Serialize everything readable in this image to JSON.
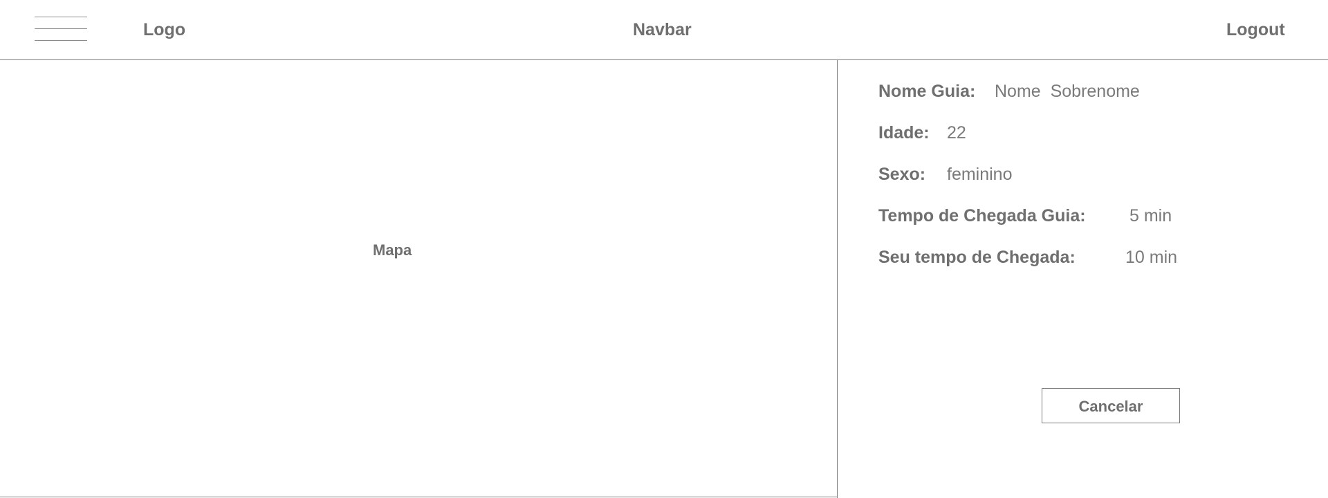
{
  "navbar": {
    "menu_icon": "hamburger-menu-icon",
    "logo_label": "Logo",
    "title": "Navbar",
    "logout_label": "Logout"
  },
  "map": {
    "label": "Mapa"
  },
  "guide_info": {
    "nome": {
      "label": "Nome Guia:",
      "value": "Nome  Sobrenome"
    },
    "idade": {
      "label": "Idade:",
      "value": "22"
    },
    "sexo": {
      "label": "Sexo:",
      "value": "feminino"
    },
    "tempo_guia": {
      "label": "Tempo de Chegada Guia:",
      "value": "5 min"
    },
    "tempo_seu": {
      "label": "Seu tempo de Chegada:",
      "value": "10 min"
    }
  },
  "actions": {
    "cancel_label": "Cancelar"
  }
}
